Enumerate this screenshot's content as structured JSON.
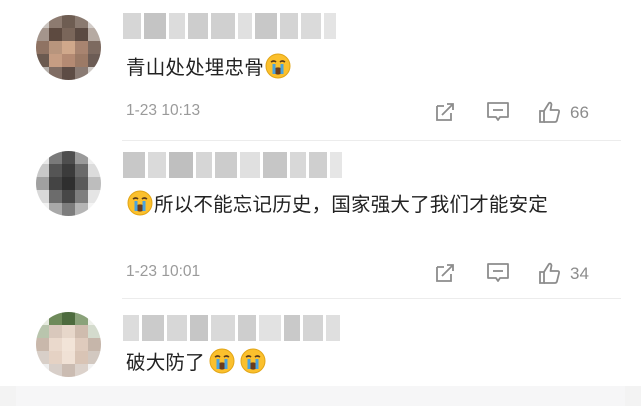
{
  "comments": [
    {
      "text": "青山处处埋忠骨",
      "emoji_after": [
        "crying-face"
      ],
      "time": "1-23 10:13",
      "likes": "66"
    },
    {
      "text": "所以不能忘记历史，国家强大了我们才能安定",
      "emoji_before": [
        "crying-face"
      ],
      "time": "1-23 10:01",
      "likes": "34"
    },
    {
      "text": "破大防了",
      "emoji_after": [
        "crying-face",
        "crying-face"
      ]
    }
  ],
  "icons": {
    "share": "share-icon",
    "reply": "comment-icon",
    "like": "thumbs-up-icon"
  },
  "colors": {
    "meta_gray": "#9a9a9a",
    "icon_gray": "#8c8c8c",
    "emoji_yellow": "#fbc02d",
    "emoji_tears": "#4aa3df"
  }
}
